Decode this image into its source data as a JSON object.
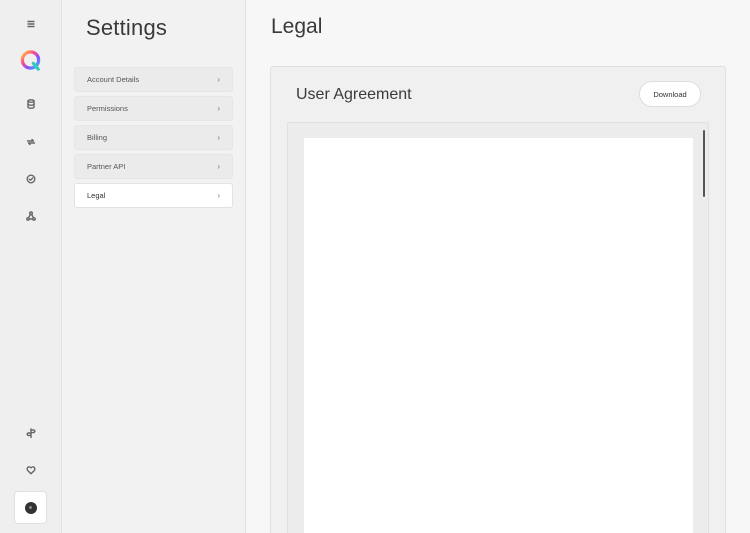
{
  "rail": {
    "icons": [
      "menu-icon",
      "logo",
      "database-icon",
      "swap-icon",
      "check-circle-icon",
      "network-icon",
      "signpost-icon",
      "heart-icon",
      "avatar"
    ]
  },
  "settings": {
    "title": "Settings",
    "items": [
      {
        "label": "Account Details",
        "chevron": "›"
      },
      {
        "label": "Permissions",
        "chevron": "›"
      },
      {
        "label": "Billing",
        "chevron": "›"
      },
      {
        "label": "Partner API",
        "chevron": "›"
      },
      {
        "label": "Legal",
        "chevron": "›",
        "active": true
      }
    ]
  },
  "main": {
    "title": "Legal",
    "card": {
      "title": "User Agreement",
      "download_label": "Download"
    }
  }
}
